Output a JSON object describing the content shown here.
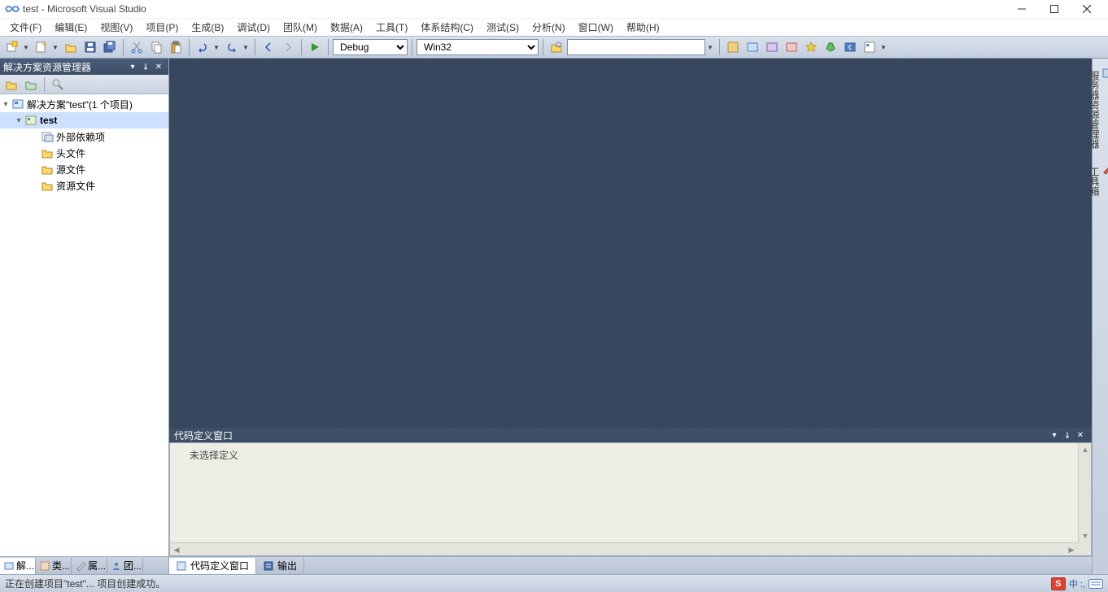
{
  "window": {
    "title": "test - Microsoft Visual Studio"
  },
  "menu": {
    "items": [
      "文件(F)",
      "编辑(E)",
      "视图(V)",
      "项目(P)",
      "生成(B)",
      "调试(D)",
      "团队(M)",
      "数据(A)",
      "工具(T)",
      "体系结构(C)",
      "测试(S)",
      "分析(N)",
      "窗口(W)",
      "帮助(H)"
    ]
  },
  "toolbar": {
    "config": "Debug",
    "platform": "Win32",
    "search": ""
  },
  "solution_panel": {
    "title": "解决方案资源管理器",
    "root": "解决方案\"test\"(1 个项目)",
    "project": "test",
    "nodes": [
      "外部依赖项",
      "头文件",
      "源文件",
      "资源文件"
    ]
  },
  "codedef": {
    "title": "代码定义窗口",
    "body": "未选择定义"
  },
  "bottom_left_tabs": [
    "解...",
    "类...",
    "属...",
    "团..."
  ],
  "bottom_center_tabs": {
    "codedef": "代码定义窗口",
    "output": "输出"
  },
  "right_tabs": {
    "server": "服务器资源管理器",
    "toolbox": "工具箱"
  },
  "statusbar": {
    "text": "正在创建项目\"test\"... 项目创建成功。",
    "ime_logo": "S",
    "ime_lang": "中 :,"
  }
}
